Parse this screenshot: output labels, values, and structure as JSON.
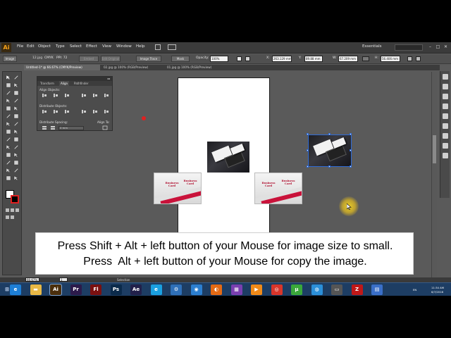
{
  "app": {
    "logo": "Ai",
    "menu": [
      "File",
      "Edit",
      "Object",
      "Type",
      "Select",
      "Effect",
      "View",
      "Window",
      "Help"
    ],
    "workspace": "Essentials"
  },
  "controlbar": {
    "image_label": "Image",
    "linked_file": "12.jpg",
    "color_mode": "CMYK",
    "ppi": "PPI: 72",
    "embed": "Embed",
    "edit_original": "Edit Original",
    "image_trace": "Image Trace",
    "mask": "Mask",
    "opacity_label": "Opacity:",
    "opacity_value": "100%",
    "x_label": "X:",
    "x_value": "263.129 mm",
    "y_label": "Y:",
    "y_value": "89.88 mm",
    "w_label": "W:",
    "w_value": "67.209 mm",
    "h_label": "H:",
    "h_value": "56.406 mm"
  },
  "tabs": [
    {
      "label": "Untitled-1* @ 66.67% (CMYK/Preview)"
    },
    {
      "label": "02.jpg @ 100% (RGB/Preview)"
    },
    {
      "label": "01.jpg @ 100% (RGB/Preview)"
    }
  ],
  "align_panel": {
    "tabs": [
      "Transform",
      "Align",
      "Pathfinder"
    ],
    "align_objects": "Align Objects:",
    "distribute_objects": "Distribute Objects:",
    "distribute_spacing": "Distribute Spacing:",
    "align_to": "Align To:",
    "spacing_value": "0 mm"
  },
  "statusbar": {
    "zoom": "66.67%",
    "page": "1",
    "tool": "Selection"
  },
  "caption": {
    "line1": "Press Shift + Alt + left button of your Mouse for image size to small.",
    "line2": "Press  Alt + left button of your Mouse for copy the image."
  },
  "card_logo": "Business\nCard",
  "taskbar": {
    "apps": [
      {
        "name": "ie-icon",
        "glyph": "e",
        "color": "#1e7fd6"
      },
      {
        "name": "folder-icon",
        "glyph": "▬",
        "color": "#e8b845"
      },
      {
        "name": "illustrator-icon",
        "glyph": "Ai",
        "color": "#4a2e0c"
      },
      {
        "name": "premiere-icon",
        "glyph": "Pr",
        "color": "#2c1a4a"
      },
      {
        "name": "flash-icon",
        "glyph": "Fl",
        "color": "#7a1010"
      },
      {
        "name": "photoshop-icon",
        "glyph": "Ps",
        "color": "#0b2a4a"
      },
      {
        "name": "aftereffects-icon",
        "glyph": "Ae",
        "color": "#22204a"
      },
      {
        "name": "ie2-icon",
        "glyph": "e",
        "color": "#1aa0e0"
      },
      {
        "name": "settings-icon",
        "glyph": "⚙",
        "color": "#2f70b8"
      },
      {
        "name": "globe-icon",
        "glyph": "◉",
        "color": "#2c7fd0"
      },
      {
        "name": "firefox-icon",
        "glyph": "◐",
        "color": "#e46a14"
      },
      {
        "name": "apps-icon",
        "glyph": "▦",
        "color": "#7a3fb0"
      },
      {
        "name": "media-icon",
        "glyph": "▶",
        "color": "#f08a18"
      },
      {
        "name": "chrome-icon",
        "glyph": "◎",
        "color": "#d8352a"
      },
      {
        "name": "utorrent-icon",
        "glyph": "µ",
        "color": "#3aa83a"
      },
      {
        "name": "network-icon",
        "glyph": "◍",
        "color": "#2b8fd8"
      },
      {
        "name": "terminal-icon",
        "glyph": "▭",
        "color": "#555555"
      },
      {
        "name": "filezilla-icon",
        "glyph": "Z",
        "color": "#c01818"
      },
      {
        "name": "disk-icon",
        "glyph": "▤",
        "color": "#3a6fc8"
      }
    ],
    "lang": "EN",
    "time": "11:34 AM",
    "date": "6/7/2016"
  },
  "colors": {
    "selection": "#2f6bd6",
    "card_red": "#c9123a",
    "cursor_highlight": "#f0d228"
  }
}
